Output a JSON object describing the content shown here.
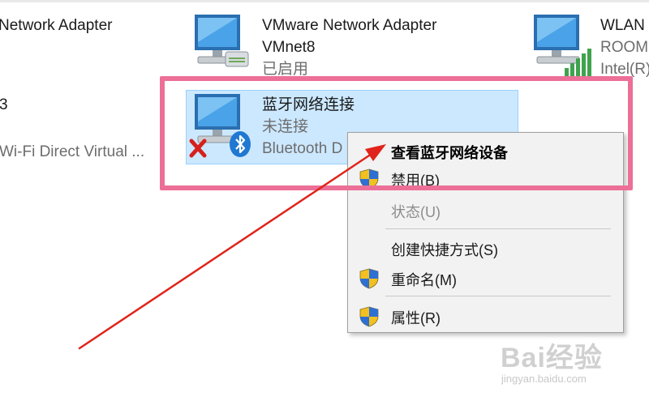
{
  "adapters": {
    "left_top": {
      "name": "Network Adapter"
    },
    "left_mid": {
      "name": "3",
      "sub": "Wi-Fi Direct Virtual ..."
    },
    "vmnet8": {
      "name_line1": "VMware Network Adapter",
      "name_line2": "VMnet8",
      "status": "已启用"
    },
    "wlan": {
      "name": "WLAN",
      "line2": "ROOM",
      "line3": "Intel(R)"
    },
    "bluetooth": {
      "name": "蓝牙网络连接",
      "status": "未连接",
      "device": "Bluetooth D"
    }
  },
  "context_menu": {
    "items": [
      {
        "label": "查看蓝牙网络设备",
        "bold": true,
        "shield": false,
        "disabled": false
      },
      {
        "label": "禁用(B)",
        "bold": false,
        "shield": true,
        "disabled": false
      },
      {
        "label": "状态(U)",
        "bold": false,
        "shield": false,
        "disabled": true
      },
      {
        "label": "创建快捷方式(S)",
        "bold": false,
        "shield": false,
        "disabled": false
      },
      {
        "label": "重命名(M)",
        "bold": false,
        "shield": true,
        "disabled": false
      },
      {
        "label": "属性(R)",
        "bold": false,
        "shield": true,
        "disabled": false
      }
    ]
  },
  "watermark": {
    "brand": "Bai经验",
    "url": "jingyan.baidu.com"
  },
  "colors": {
    "highlight_frame": "#ec6f97",
    "arrow": "#e0241b",
    "selection": "#cce8ff",
    "menu_background": "#f2f2f2"
  },
  "icons": {
    "adapter": "network-adapter-icon",
    "disconnected": "red-x-icon",
    "bluetooth": "bluetooth-icon",
    "shield": "uac-shield-icon",
    "signal": "signal-bars-icon"
  }
}
